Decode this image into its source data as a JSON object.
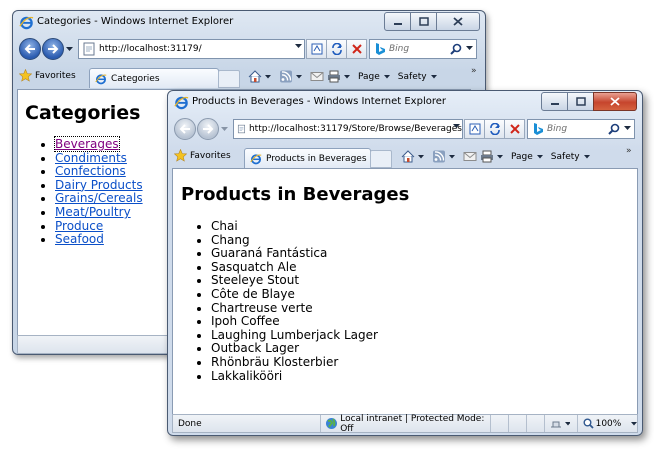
{
  "back_window": {
    "title": "Categories - Windows Internet Explorer",
    "address": "http://localhost:31179/",
    "search_placeholder": "Bing",
    "favorites_label": "Favorites",
    "tab_label": "Categories",
    "page_label": "Page",
    "safety_label": "Safety",
    "heading": "Categories",
    "categories": [
      "Beverages",
      "Condiments",
      "Confections",
      "Dairy Products",
      "Grains/Cereals",
      "Meat/Poultry",
      "Produce",
      "Seafood"
    ]
  },
  "front_window": {
    "title": "Products in Beverages - Windows Internet Explorer",
    "address": "http://localhost:31179/Store/Browse/Beverages",
    "search_placeholder": "Bing",
    "favorites_label": "Favorites",
    "tab_label": "Products in Beverages",
    "page_label": "Page",
    "safety_label": "Safety",
    "heading": "Products in Beverages",
    "products": [
      "Chai",
      "Chang",
      "Guaraná Fantástica",
      "Sasquatch Ale",
      "Steeleye Stout",
      "Côte de Blaye",
      "Chartreuse verte",
      "Ipoh Coffee",
      "Laughing Lumberjack Lager",
      "Outback Lager",
      "Rhönbräu Klosterbier",
      "Lakkalikööri"
    ],
    "status": {
      "left": "Done",
      "zone": "Local intranet | Protected Mode: Off",
      "zoom": "100%"
    }
  },
  "colors": {
    "link": "#0b4fc8",
    "visited_link": "#800080",
    "close_button": "#c6452d"
  },
  "icons": [
    "ie-icon",
    "back-arrow-icon",
    "forward-arrow-icon",
    "page-icon",
    "compatibility-icon",
    "refresh-icon",
    "stop-icon",
    "bing-icon",
    "search-icon",
    "favorites-star-icon",
    "home-icon",
    "feeds-icon",
    "mail-icon",
    "print-icon",
    "zone-globe-icon",
    "zoom-icon"
  ]
}
